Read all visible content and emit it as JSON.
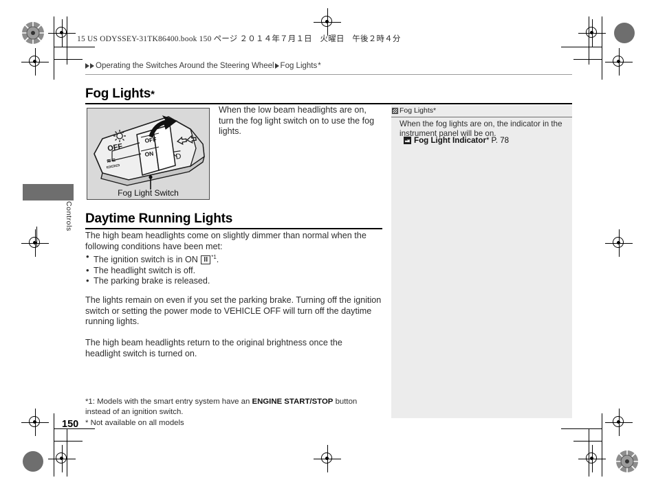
{
  "book_header": "15 US ODYSSEY-31TK86400.book  150 ページ  ２０１４年７月１日　火曜日　午後２時４分",
  "breadcrumb": {
    "parent": "Operating the Switches Around the Steering Wheel",
    "current": "Fog Lights",
    "current_star": "*"
  },
  "sections": [
    {
      "title": "Fog Lights",
      "title_star": "*",
      "intro": "When the low beam headlights are on, turn the fog light switch on to use the fog lights."
    },
    {
      "title": "Daytime Running Lights",
      "intro": "The high beam headlights come on slightly dimmer than normal when the following conditions have been met:",
      "bullets": [
        {
          "pre": "The ignition switch is in ON ",
          "key": "II",
          "post": "."
        },
        {
          "pre": "The headlight switch is off.",
          "key": "",
          "post": ""
        },
        {
          "pre": "The parking brake is released.",
          "key": "",
          "post": ""
        }
      ],
      "para2": "The lights remain on even if you set the parking brake. Turning off the ignition switch or setting the power mode to VEHICLE OFF will turn off the daytime running lights.",
      "para3": "The high beam headlights return to the original brightness once the headlight switch is turned on."
    }
  ],
  "figure": {
    "caption": "Fog Light Switch",
    "switch_labels": {
      "off_main": "OFF",
      "off_small": "OFF",
      "on_small": "ON"
    }
  },
  "note": {
    "heading": "Fog Lights",
    "heading_star": "*",
    "body": "When the fog lights are on, the indicator in the instrument panel will be on.",
    "reference_label": "Fog Light Indicator",
    "reference_star": "*",
    "reference_page": "P. 78"
  },
  "footnotes": {
    "line1_pre": "*1: Models with the smart entry system have an ",
    "line1_bold": "ENGINE START/STOP",
    "line1_post": " button instead of an ignition switch.",
    "line2": "* Not available on all models"
  },
  "page_number": "150",
  "side_tab_label": "Controls",
  "colors": {
    "figure_background": "#d9d9d9",
    "note_panel": "#ececec",
    "side_tab": "#6e6e6e"
  }
}
